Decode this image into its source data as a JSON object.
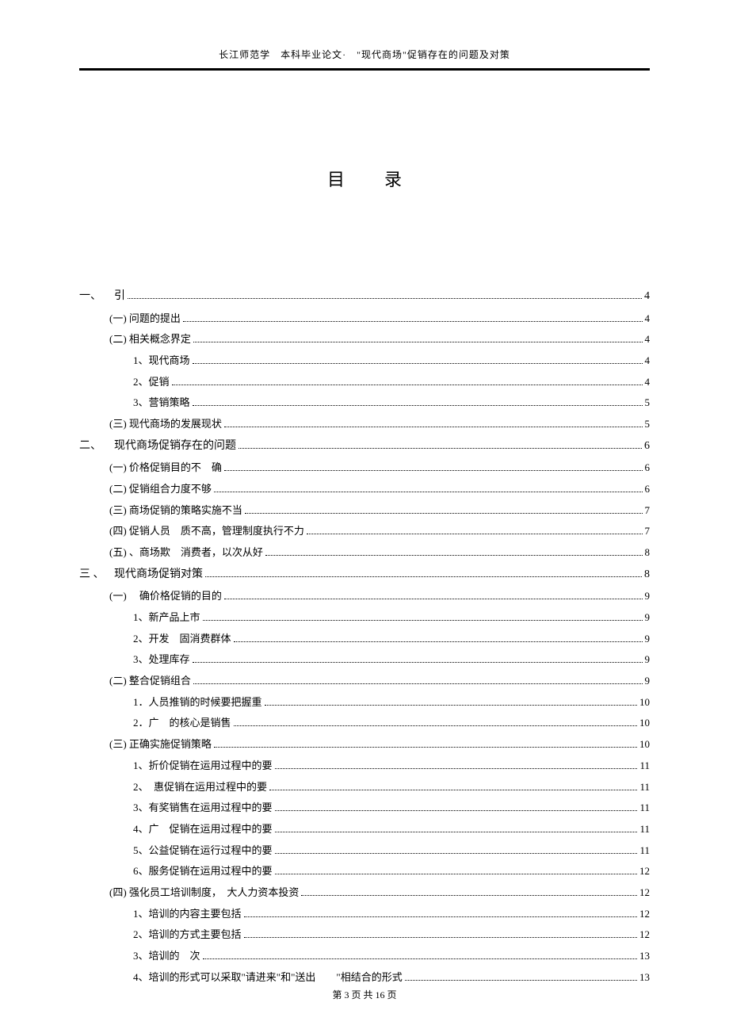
{
  "header": {
    "text": "长江师范学　本科毕业论文·　\"现代商场\"促销存在的问题及对策"
  },
  "title": "目录",
  "toc": [
    {
      "level": 1,
      "marker": "一、",
      "label": "引",
      "page": "4"
    },
    {
      "level": 2,
      "label": "(一) 问题的提出",
      "page": "4"
    },
    {
      "level": 2,
      "label": "(二) 相关概念界定",
      "page": "4"
    },
    {
      "level": 3,
      "label": "1、现代商场",
      "page": "4"
    },
    {
      "level": 3,
      "label": "2、促销",
      "page": "4"
    },
    {
      "level": 3,
      "label": "3、营销策略",
      "page": "5"
    },
    {
      "level": 2,
      "label": "(三) 现代商场的发展现状",
      "page": "5"
    },
    {
      "level": 1,
      "marker": "二、",
      "label": "现代商场促销存在的问题",
      "page": "6"
    },
    {
      "level": 2,
      "label": "(一) 价格促销目的不　确",
      "page": "6"
    },
    {
      "level": 2,
      "label": "(二) 促销组合力度不够",
      "page": "6"
    },
    {
      "level": 2,
      "label": "(三) 商场促销的策略实施不当",
      "page": "7"
    },
    {
      "level": 2,
      "label": "(四) 促销人员　质不高，管理制度执行不力",
      "page": "7"
    },
    {
      "level": 2,
      "label": "(五) 、商场欺　消费者，以次从好",
      "page": "8"
    },
    {
      "level": 1,
      "marker": "三 、",
      "label": "现代商场促销对策",
      "page": "8"
    },
    {
      "level": 2,
      "label": "(一) 　确价格促销的目的",
      "page": "9"
    },
    {
      "level": 3,
      "label": "1、新产品上市",
      "page": "9"
    },
    {
      "level": 3,
      "label": "2、开发　固消费群体",
      "page": "9"
    },
    {
      "level": 3,
      "label": "3、处理库存",
      "page": "9"
    },
    {
      "level": 2,
      "label": "(二) 整合促销组合",
      "page": "9"
    },
    {
      "level": 3,
      "label": "1．人员推销的时候要把握重",
      "page": "10"
    },
    {
      "level": 3,
      "label": "2．广　的核心是销售",
      "page": "10"
    },
    {
      "level": 2,
      "label": "(三) 正确实施促销策略",
      "page": "10"
    },
    {
      "level": 3,
      "label": "1、折价促销在运用过程中的要",
      "page": "11"
    },
    {
      "level": 3,
      "label": "2、　惠促销在运用过程中的要",
      "page": "11"
    },
    {
      "level": 3,
      "label": "3、有奖销售在运用过程中的要",
      "page": "11"
    },
    {
      "level": 3,
      "label": "4、广　促销在运用过程中的要",
      "page": "11"
    },
    {
      "level": 3,
      "label": "5、公益促销在运行过程中的要",
      "page": "11"
    },
    {
      "level": 3,
      "label": "6、服务促销在运用过程中的要",
      "page": "12"
    },
    {
      "level": 2,
      "label": "(四) 强化员工培训制度，　大人力资本投资",
      "page": "12"
    },
    {
      "level": 3,
      "label": "1、培训的内容主要包括",
      "page": "12"
    },
    {
      "level": 3,
      "label": "2、培训的方式主要包括",
      "page": "12"
    },
    {
      "level": 3,
      "label": "3、培训的　次",
      "page": "13"
    },
    {
      "level": 3,
      "label": "4、培训的形式可以采取\"请进来\"和\"送出　　\"相结合的形式",
      "page": "13"
    }
  ],
  "footer": {
    "prefix": "第 ",
    "current": "3",
    "mid": " 页 共 ",
    "total": "16",
    "suffix": " 页"
  }
}
